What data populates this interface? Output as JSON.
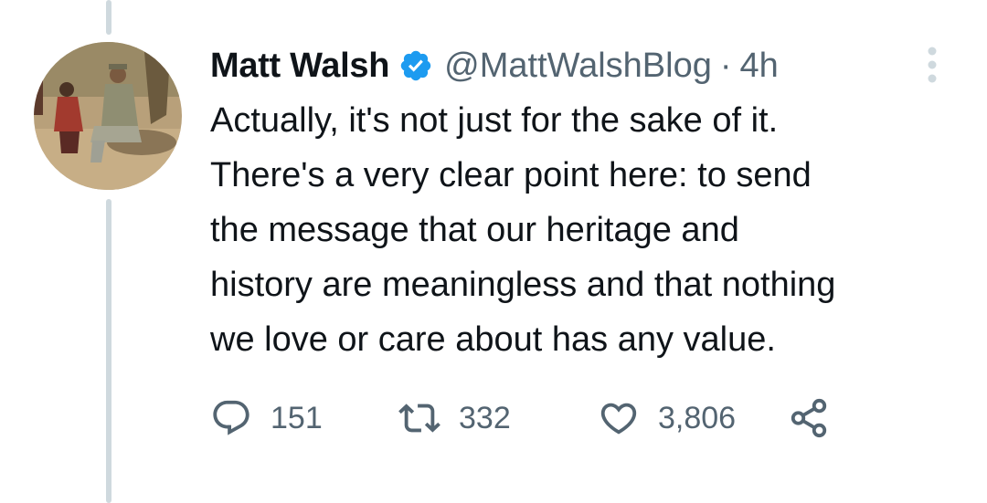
{
  "tweet": {
    "author": {
      "name": "Matt Walsh",
      "handle": "@MattWalshBlog",
      "verified": true,
      "avatar_icon": "profile-photo"
    },
    "separator": "·",
    "time": "4h",
    "text": "Actually, it's not just for the sake of it.\nThere's a very clear point here: to send\nthe message that our heritage and\nhistory are meaningless and that nothing\nwe love or care about has any value.",
    "stats": {
      "replies": "151",
      "retweets": "332",
      "likes": "3,806"
    },
    "icons": {
      "reply": "reply-icon",
      "retweet": "retweet-icon",
      "like": "heart-icon",
      "share": "share-icon",
      "more": "more-icon",
      "verified": "verified-badge-icon"
    }
  },
  "colors": {
    "text": "#0f1419",
    "secondary": "#536471",
    "verified_blue": "#1d9bf0",
    "thread_line": "#cfd9de"
  }
}
